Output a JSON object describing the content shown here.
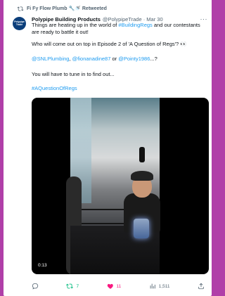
{
  "retweet_banner": {
    "label": "Fi Fy Flow Plumb 🔧🚿 Retweeted"
  },
  "tweet": {
    "avatar_text": "Polypipe Trade",
    "author_name": "Polypipe Building Products",
    "handle_date": "@PolypipeTrade · Mar 30",
    "more": "···",
    "text_line1_before": "Things are heating up in the world of ",
    "hashtag1": "#BuildingRegs",
    "text_line1_after": " and our contestants are ready to battle it out!",
    "paragraph2": "Who will come out on top in Episode 2 of 'A Question of Regs'? 👀",
    "mention1": "@SNLPlumbing",
    "mention_sep1": ", ",
    "mention2": "@fionanadine87",
    "mention_or": " or ",
    "mention3": "@Pointy1986",
    "mention_end": "...?",
    "paragraph4": "You will have to tune in to find out...",
    "hashtag2": "#AQuestionOfRegs",
    "video_time": "0:13"
  },
  "actions": {
    "retweets": "7",
    "likes": "11",
    "views": "1,511"
  },
  "colors": {
    "background": "#b03fa8",
    "link": "#1d9bf0",
    "retweet": "#00ba7c",
    "like": "#f91880"
  }
}
